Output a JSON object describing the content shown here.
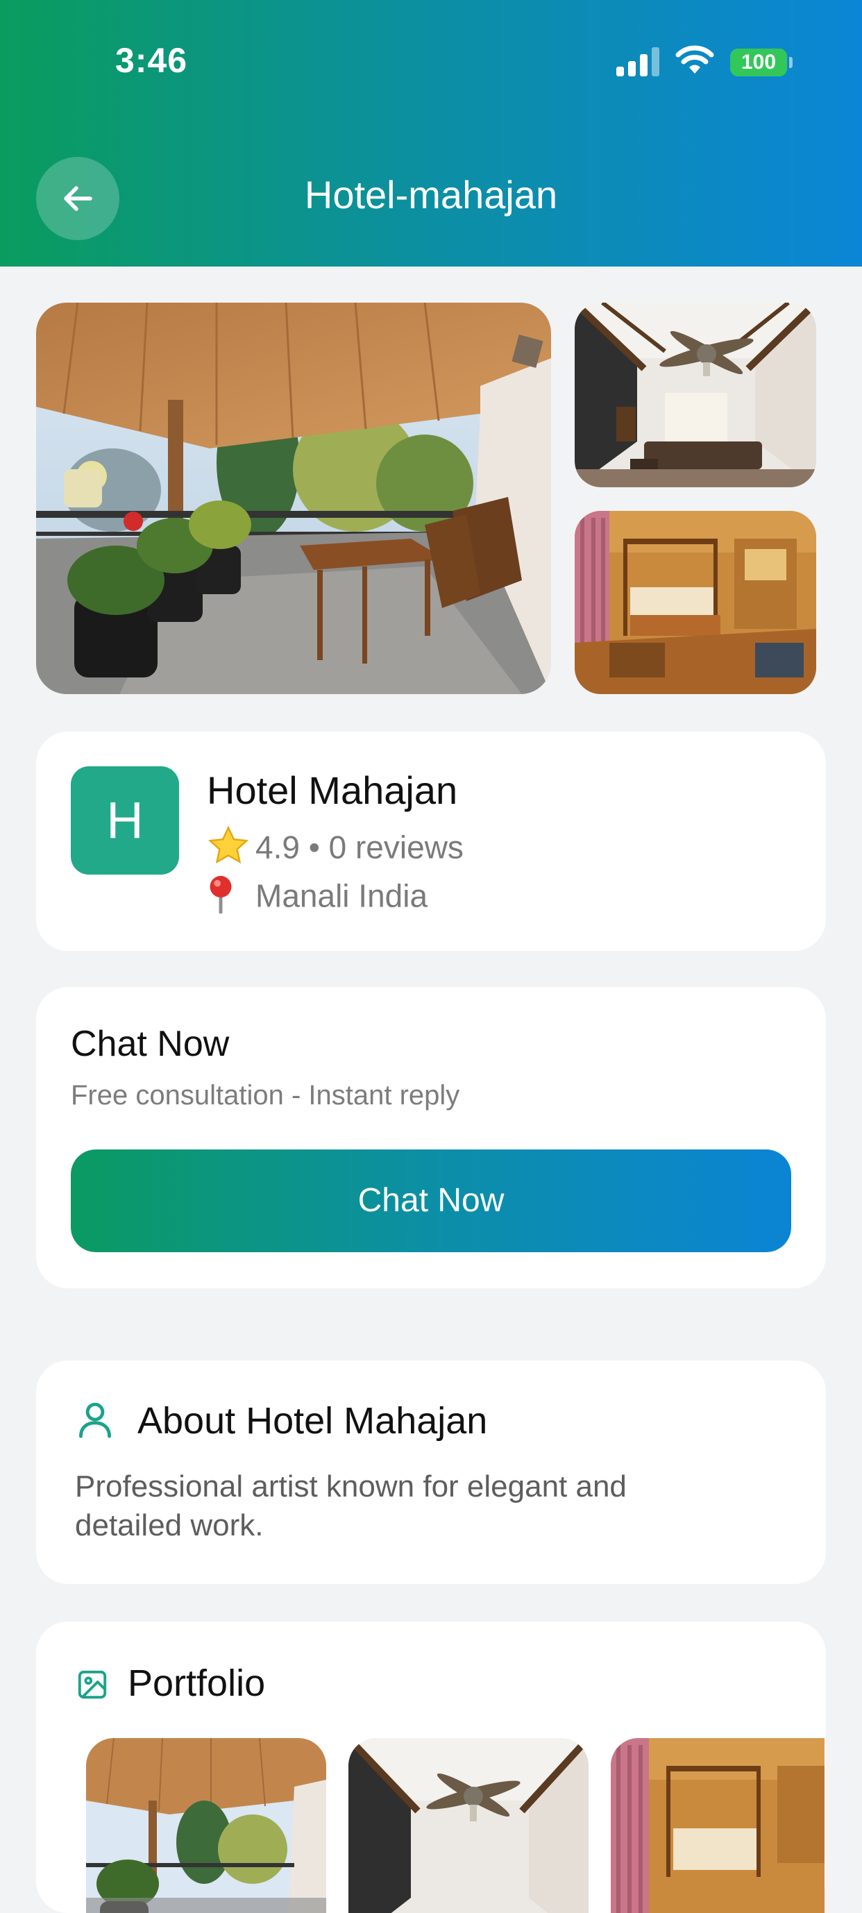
{
  "status_bar": {
    "time": "3:46",
    "battery": "100"
  },
  "header": {
    "title": "Hotel-mahajan",
    "back_icon": "arrow-left-icon"
  },
  "colors": {
    "brand_green": "#0a9c5e",
    "brand_blue": "#0b86d6",
    "avatar_teal": "#21a98a",
    "battery_green": "#33c759"
  },
  "gallery": {
    "images": [
      "balcony-photo",
      "living-room-photo",
      "bedroom-photo"
    ]
  },
  "hotel": {
    "initial": "H",
    "name": "Hotel Mahajan",
    "rating": "4.9",
    "separator": "•",
    "reviews": "0 reviews",
    "location": "Manali India",
    "rating_icon": "star-icon",
    "location_icon": "pin-icon"
  },
  "chat": {
    "title": "Chat Now",
    "subtitle": "Free consultation - Instant reply",
    "button_label": "Chat Now"
  },
  "about": {
    "icon": "user-icon",
    "title": "About Hotel Mahajan",
    "text": "Professional artist known for elegant and detailed work."
  },
  "portfolio": {
    "icon": "image-icon",
    "title": "Portfolio",
    "items": [
      "balcony-photo",
      "living-room-photo",
      "bedroom-photo"
    ]
  }
}
